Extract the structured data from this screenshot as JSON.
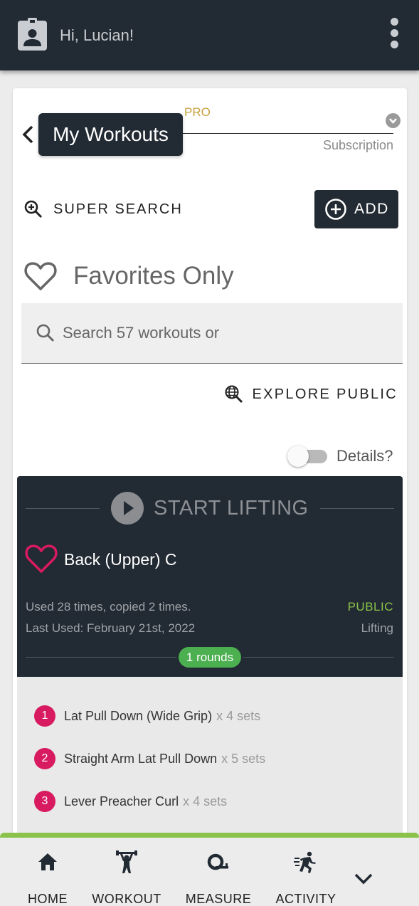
{
  "header": {
    "greeting": "Hi, Lucian!"
  },
  "page": {
    "title": "My Workouts",
    "subscription_label": "PRO",
    "subscription_value": "Subscription"
  },
  "actions": {
    "super_search": "SUPER SEARCH",
    "add": "ADD",
    "explore_public": "EXPLORE PUBLIC"
  },
  "favorites_filter": {
    "label": "Favorites Only"
  },
  "search": {
    "placeholder": "Search 57 workouts or"
  },
  "details_toggle": {
    "label": "Details?",
    "on": false
  },
  "workout": {
    "start_label": "START LIFTING",
    "name": "Back (Upper) C",
    "usage": "Used 28 times, copied 2 times.",
    "last_used": "Last Used: February 21st, 2022",
    "visibility": "PUBLIC",
    "type": "Lifting",
    "rounds": "1 rounds",
    "exercises": [
      {
        "num": "1",
        "name": "Lat Pull Down (Wide Grip)",
        "sets": "x 4 sets"
      },
      {
        "num": "2",
        "name": "Straight Arm Lat Pull Down",
        "sets": "x 5 sets"
      },
      {
        "num": "3",
        "name": "Lever Preacher Curl",
        "sets": "x 4 sets"
      }
    ]
  },
  "nav": {
    "items": [
      {
        "label": "HOME",
        "icon": "home-icon"
      },
      {
        "label": "WORKOUT",
        "icon": "weightlifter-icon"
      },
      {
        "label": "MEASURE",
        "icon": "tape-measure-icon"
      },
      {
        "label": "ACTIVITY",
        "icon": "run-icon"
      }
    ]
  },
  "colors": {
    "dark": "#222a33",
    "accent_green": "#8bc34a",
    "pro_gold": "#c9a13e",
    "pink": "#d81b60",
    "rounds_green": "#4caf50"
  }
}
